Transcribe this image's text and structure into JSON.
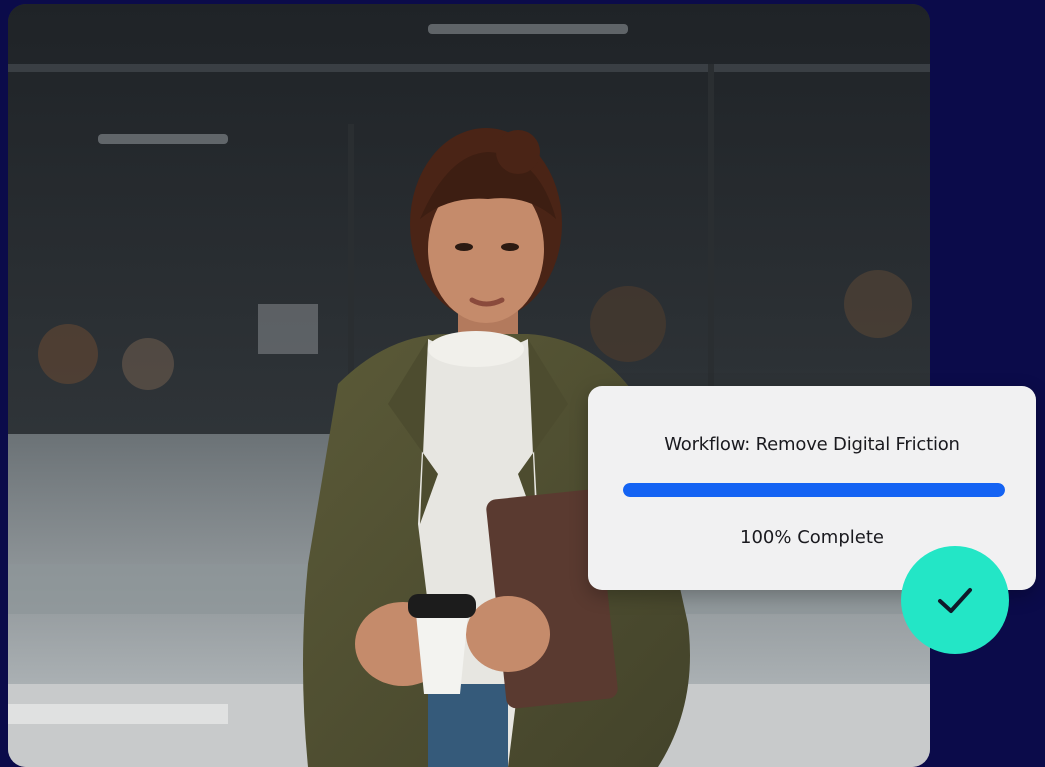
{
  "workflow_card": {
    "title": "Workflow: Remove Digital Friction",
    "status": "100% Complete",
    "progress_percent": 100
  },
  "icons": {
    "check": "checkmark-icon"
  },
  "colors": {
    "background": "#0b0b4a",
    "card": "#f1f1f2",
    "progress": "#1463f3",
    "badge": "#23e6c6"
  }
}
